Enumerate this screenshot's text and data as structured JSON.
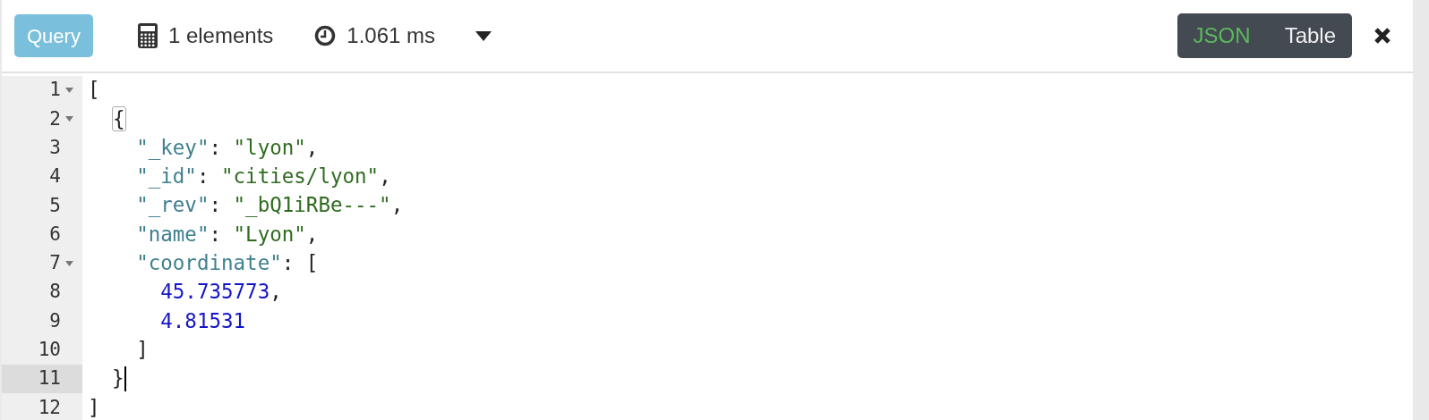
{
  "toolbar": {
    "query_button": "Query",
    "count": "1 elements",
    "time": "1.061 ms",
    "view_toggle": [
      {
        "label": "JSON",
        "selected": true
      },
      {
        "label": "Table",
        "selected": false
      }
    ]
  },
  "editor": {
    "lines": [
      {
        "number": "1",
        "foldable": true,
        "selected": false,
        "matched": false,
        "tokens": [
          {
            "kind": "punct",
            "text": "["
          }
        ]
      },
      {
        "number": "2",
        "foldable": true,
        "selected": false,
        "matched": true,
        "tokens": [
          {
            "kind": "punct",
            "text": "  {"
          }
        ]
      },
      {
        "number": "3",
        "foldable": false,
        "selected": false,
        "matched": false,
        "tokens": [
          {
            "kind": "key",
            "text": "    \"_key\""
          },
          {
            "kind": "punct",
            "text": ": "
          },
          {
            "kind": "string",
            "text": "\"lyon\""
          },
          {
            "kind": "punct",
            "text": ","
          }
        ]
      },
      {
        "number": "4",
        "foldable": false,
        "selected": false,
        "matched": false,
        "tokens": [
          {
            "kind": "key",
            "text": "    \"_id\""
          },
          {
            "kind": "punct",
            "text": ": "
          },
          {
            "kind": "string",
            "text": "\"cities/lyon\""
          },
          {
            "kind": "punct",
            "text": ","
          }
        ]
      },
      {
        "number": "5",
        "foldable": false,
        "selected": false,
        "matched": false,
        "tokens": [
          {
            "kind": "key",
            "text": "    \"_rev\""
          },
          {
            "kind": "punct",
            "text": ": "
          },
          {
            "kind": "string",
            "text": "\"_bQ1iRBe---\""
          },
          {
            "kind": "punct",
            "text": ","
          }
        ]
      },
      {
        "number": "6",
        "foldable": false,
        "selected": false,
        "matched": false,
        "tokens": [
          {
            "kind": "key",
            "text": "    \"name\""
          },
          {
            "kind": "punct",
            "text": ": "
          },
          {
            "kind": "string",
            "text": "\"Lyon\""
          },
          {
            "kind": "punct",
            "text": ","
          }
        ]
      },
      {
        "number": "7",
        "foldable": true,
        "selected": false,
        "matched": false,
        "tokens": [
          {
            "kind": "key",
            "text": "    \"coordinate\""
          },
          {
            "kind": "punct",
            "text": ": ["
          }
        ]
      },
      {
        "number": "8",
        "foldable": false,
        "selected": false,
        "matched": false,
        "tokens": [
          {
            "kind": "number",
            "text": "      45.735773"
          },
          {
            "kind": "punct",
            "text": ","
          }
        ]
      },
      {
        "number": "9",
        "foldable": false,
        "selected": false,
        "matched": false,
        "tokens": [
          {
            "kind": "number",
            "text": "      4.81531"
          }
        ]
      },
      {
        "number": "10",
        "foldable": false,
        "selected": false,
        "matched": false,
        "tokens": [
          {
            "kind": "punct",
            "text": "    ]"
          }
        ]
      },
      {
        "number": "11",
        "foldable": false,
        "selected": true,
        "matched": false,
        "tokens": [
          {
            "kind": "punct",
            "text": "  }"
          }
        ]
      },
      {
        "number": "12",
        "foldable": false,
        "selected": false,
        "matched": false,
        "tokens": [
          {
            "kind": "punct",
            "text": "]"
          }
        ]
      }
    ]
  }
}
